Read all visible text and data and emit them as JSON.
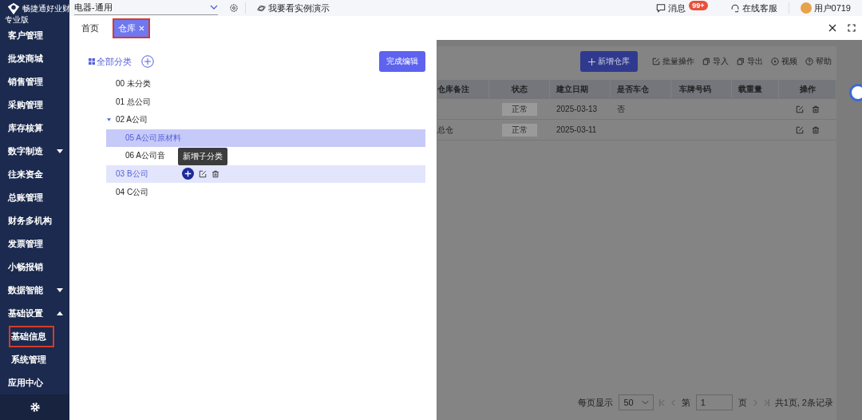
{
  "app": {
    "logo_text": "畅捷通好业财",
    "edition": "专业版"
  },
  "sidebar": {
    "items": [
      {
        "label": "客户管理",
        "kind": "item",
        "selected": false
      },
      {
        "label": "批发商城",
        "kind": "item",
        "selected": false
      },
      {
        "label": "销售管理",
        "kind": "item",
        "selected": false
      },
      {
        "label": "采购管理",
        "kind": "item",
        "selected": false
      },
      {
        "label": "库存核算",
        "kind": "item",
        "selected": false
      },
      {
        "label": "数字制造",
        "kind": "group",
        "selected": false,
        "expanded": false
      },
      {
        "label": "往来资金",
        "kind": "item",
        "selected": false
      },
      {
        "label": "总账管理",
        "kind": "item",
        "selected": false
      },
      {
        "label": "财务多机构",
        "kind": "item",
        "selected": false
      },
      {
        "label": "发票管理",
        "kind": "item",
        "selected": false
      },
      {
        "label": "小畅报销",
        "kind": "item",
        "selected": false
      },
      {
        "label": "数据智能",
        "kind": "group",
        "selected": false,
        "expanded": false
      },
      {
        "label": "基础设置",
        "kind": "group",
        "selected": false,
        "expanded": true,
        "children": [
          {
            "label": "基础信息",
            "selected": true
          },
          {
            "label": "系统管理",
            "selected": false
          }
        ]
      },
      {
        "label": "应用中心",
        "kind": "item",
        "selected": false
      }
    ]
  },
  "topbar": {
    "account": "电器-通用",
    "demo": "我要看实例演示",
    "messages": "消息",
    "badge": "99+",
    "service": "在线客服",
    "user": "用户0719"
  },
  "tabs": [
    {
      "label": "首页",
      "selected": false,
      "closable": false
    },
    {
      "label": "仓库",
      "selected": true,
      "closable": true
    }
  ],
  "drawer": {
    "root": "全部分类",
    "done": "完成编辑",
    "tooltip": "新增子分类",
    "tree": [
      {
        "label": "00 未分类",
        "selected": false,
        "hovered": false
      },
      {
        "label": "01 总公司",
        "selected": false,
        "hovered": false
      },
      {
        "label": "02 A公司",
        "selected": false,
        "hovered": false,
        "expanded": true,
        "children": [
          {
            "label": "05 A公司原材料",
            "selected": true,
            "hovered": false
          },
          {
            "label": "06 A公司音",
            "selected": false,
            "hovered": false
          }
        ]
      },
      {
        "label": "03 B公司",
        "selected": false,
        "hovered": true
      },
      {
        "label": "04 C公司",
        "selected": false,
        "hovered": false
      }
    ]
  },
  "toolbar": [
    {
      "label": "新增仓库",
      "kind": "primary"
    },
    {
      "label": "批量操作",
      "kind": "edit"
    },
    {
      "label": "导入",
      "kind": "import"
    },
    {
      "label": "导出",
      "kind": "export"
    },
    {
      "label": "视频",
      "kind": "video"
    },
    {
      "label": "帮助",
      "kind": "help"
    }
  ],
  "table": {
    "columns": [
      "仓库备注",
      "状态",
      "建立日期",
      "是否车仓",
      "车牌号码",
      "载重量",
      "操作"
    ],
    "rows": [
      {
        "status": "正常",
        "date": "2025-03-13",
        "vehicle": "否"
      },
      {
        "note": "总仓",
        "status": "正常",
        "date": "2025-03-11"
      }
    ]
  },
  "pagination": {
    "per_page_label": "每页显示",
    "per_page": "50",
    "page_prefix": "第",
    "page": "1",
    "page_suffix": "页",
    "summary": "共1页, 2条记录"
  }
}
